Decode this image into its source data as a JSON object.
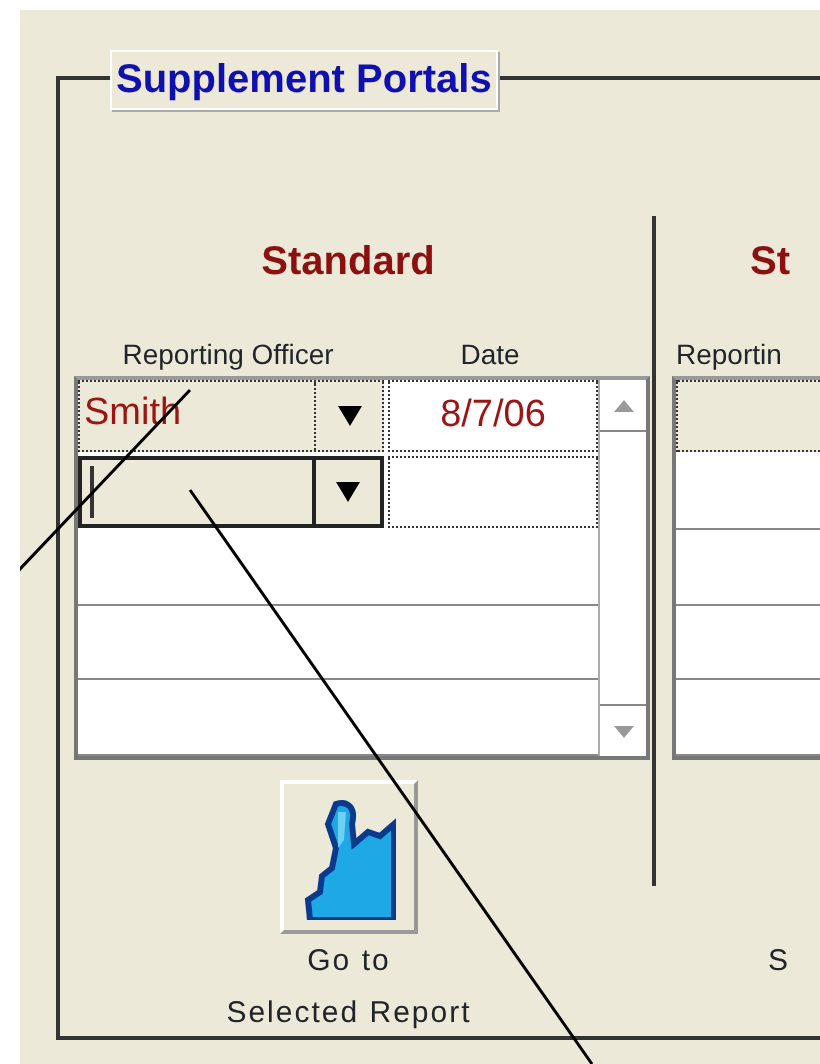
{
  "group": {
    "title": "Supplement Portals"
  },
  "portals": [
    {
      "heading": "Standard",
      "columns": [
        "Reporting Officer",
        "Date"
      ],
      "rows": [
        {
          "kind": "entry",
          "officer": "Smith",
          "date": "8/7/06",
          "focused": false
        },
        {
          "kind": "entry",
          "focused": true
        },
        {
          "kind": "blank"
        },
        {
          "kind": "blank"
        },
        {
          "kind": "blank"
        }
      ],
      "button": {
        "label": "Go to\nSelected Report"
      }
    },
    {
      "heading": "St",
      "columns": [
        "Reportin"
      ],
      "rows": [
        {
          "kind": "entry",
          "focused": false
        },
        {
          "kind": "blank"
        },
        {
          "kind": "blank"
        },
        {
          "kind": "blank"
        },
        {
          "kind": "blank"
        }
      ],
      "button": {
        "label": "S"
      }
    }
  ]
}
